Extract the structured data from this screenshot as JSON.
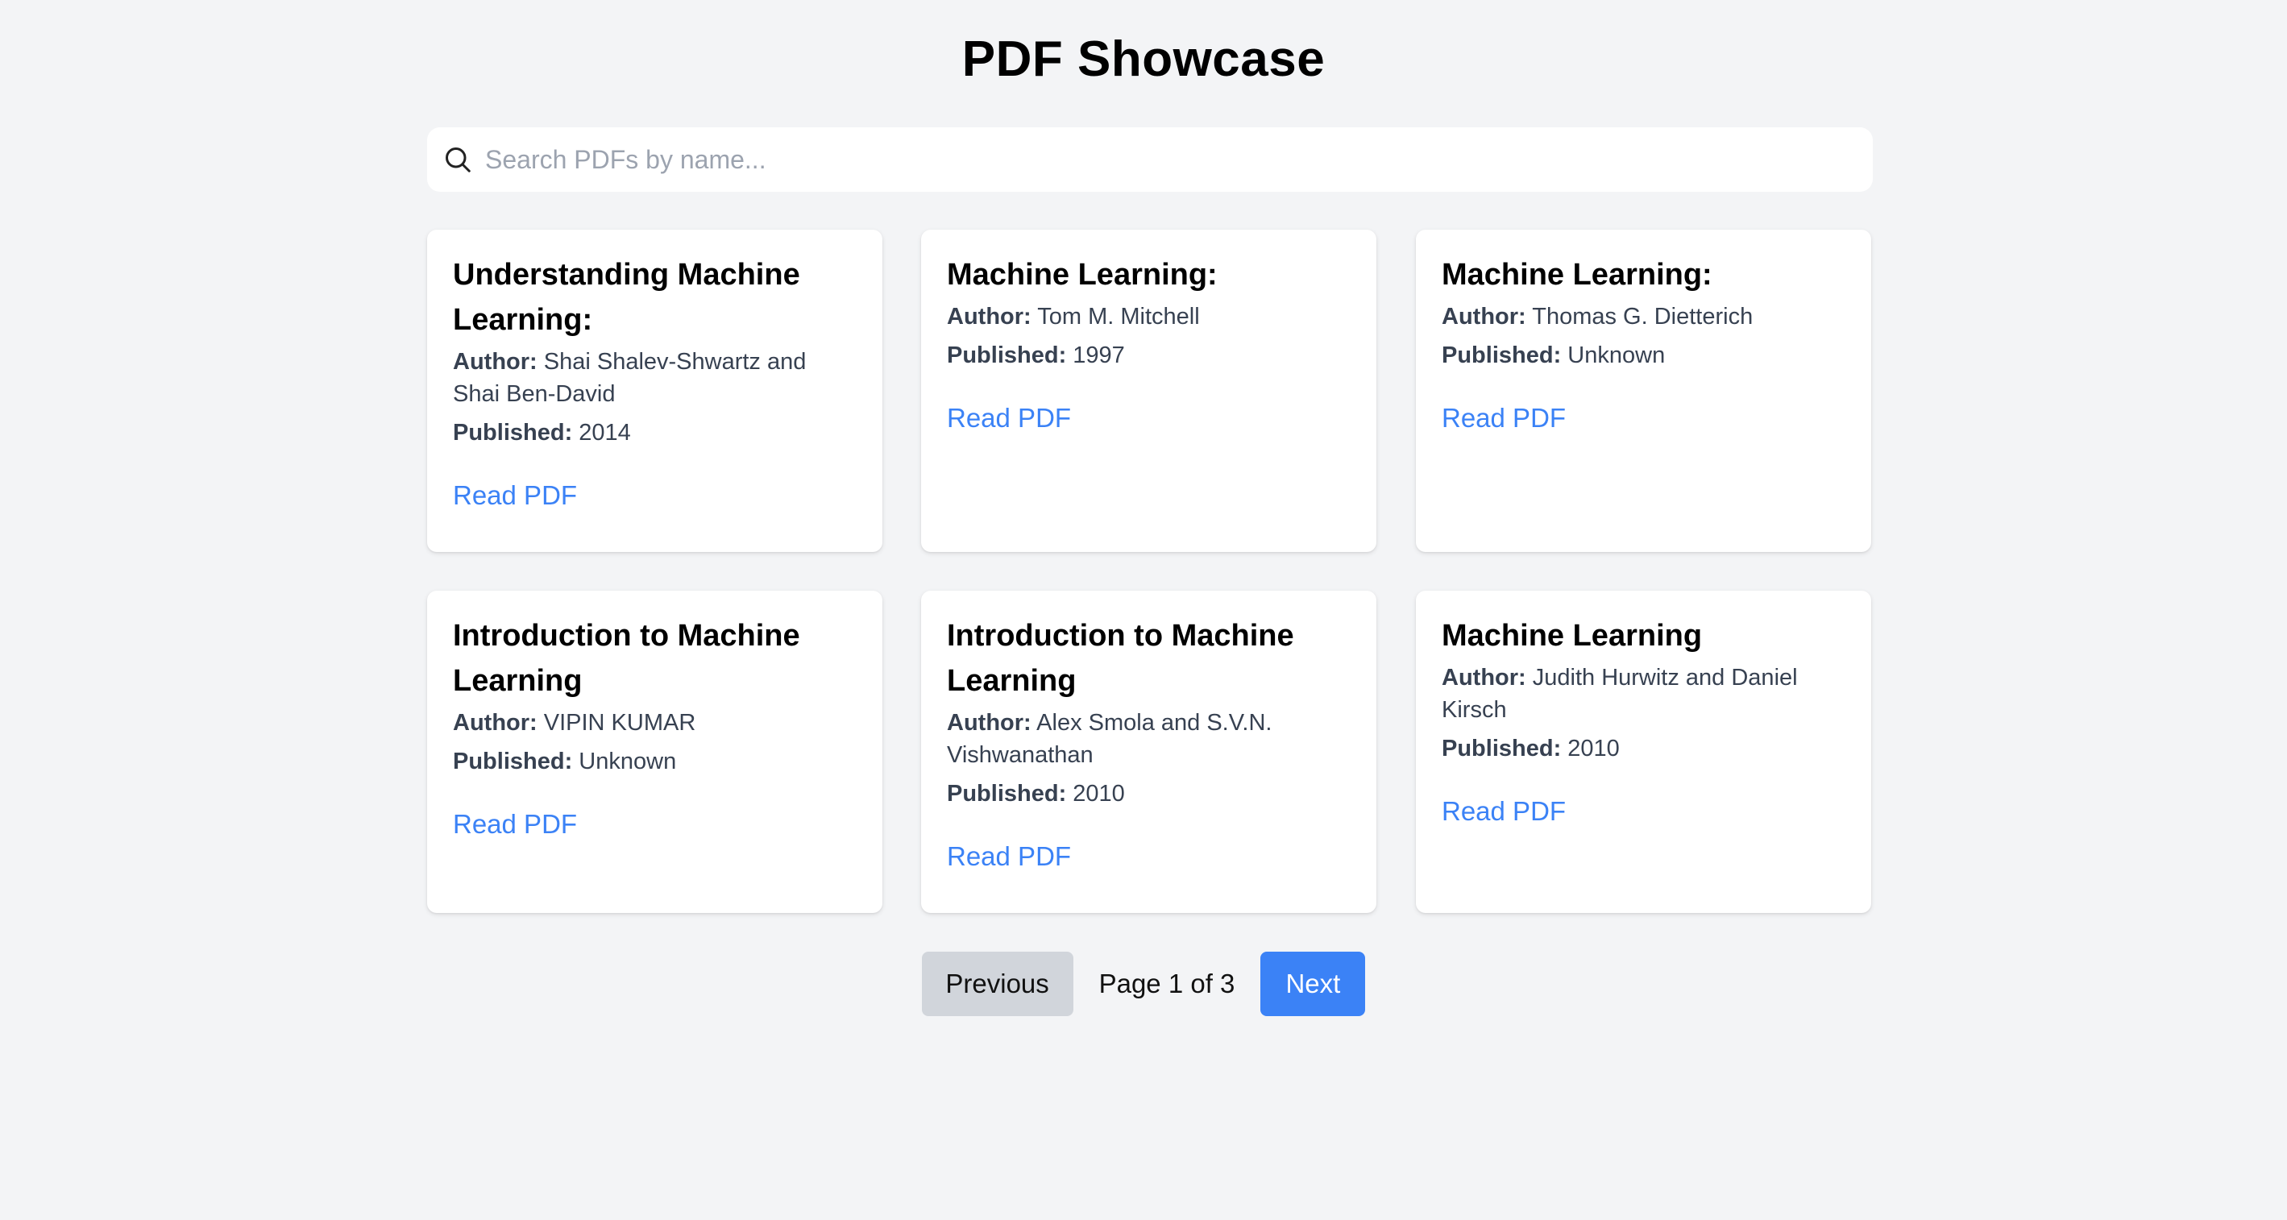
{
  "header": {
    "title": "PDF Showcase"
  },
  "search": {
    "placeholder": "Search PDFs by name...",
    "value": "",
    "icon": "search-icon"
  },
  "labels": {
    "author": "Author:",
    "published": "Published:",
    "read": "Read PDF"
  },
  "cards": [
    {
      "title": "Understanding Machine Learning:",
      "author": "Shai Shalev-Shwartz and Shai Ben-David",
      "published": "2014"
    },
    {
      "title": "Machine Learning:",
      "author": "Tom M. Mitchell",
      "published": "1997"
    },
    {
      "title": "Machine Learning:",
      "author": "Thomas G. Dietterich",
      "published": "Unknown"
    },
    {
      "title": "Introduction to Machine Learning",
      "author": "VIPIN KUMAR",
      "published": "Unknown"
    },
    {
      "title": "Introduction to Machine Learning",
      "author": "Alex Smola and S.V.N. Vishwanathan",
      "published": "2010"
    },
    {
      "title": "Machine Learning",
      "author": "Judith Hurwitz and Daniel Kirsch",
      "published": "2010"
    }
  ],
  "pagination": {
    "previous_label": "Previous",
    "page_text": "Page 1 of 3",
    "next_label": "Next"
  },
  "colors": {
    "background": "#f3f4f6",
    "card": "#ffffff",
    "link": "#3b82f6",
    "next_button": "#3b82f6",
    "previous_button": "#d1d5db"
  }
}
